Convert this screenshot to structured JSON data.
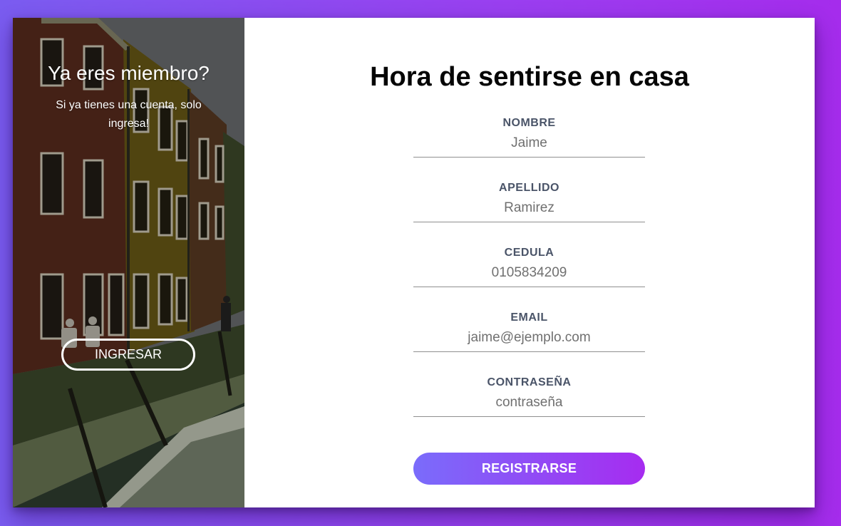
{
  "colors": {
    "background_start": "#7a5cf0",
    "background_end": "#a52cec",
    "label": "#4a5468",
    "button_start": "#7a6cfb",
    "button_end": "#a62cf0"
  },
  "sidebar": {
    "image": "building-photo",
    "title": "Ya eres miembro?",
    "text": "Si ya tienes una cuenta, solo ingresa!",
    "button_label": "INGRESAR"
  },
  "form": {
    "title": "Hora de sentirse en casa",
    "fields": [
      {
        "label": "NOMBRE",
        "placeholder": "Jaime",
        "type": "text"
      },
      {
        "label": "APELLIDO",
        "placeholder": "Ramirez",
        "type": "text"
      },
      {
        "label": "CEDULA",
        "placeholder": "0105834209",
        "type": "text"
      },
      {
        "label": "EMAIL",
        "placeholder": "jaime@ejemplo.com",
        "type": "email"
      },
      {
        "label": "CONTRASEÑA",
        "placeholder": "contraseña",
        "type": "password"
      }
    ],
    "submit_label": "REGISTRARSE"
  }
}
